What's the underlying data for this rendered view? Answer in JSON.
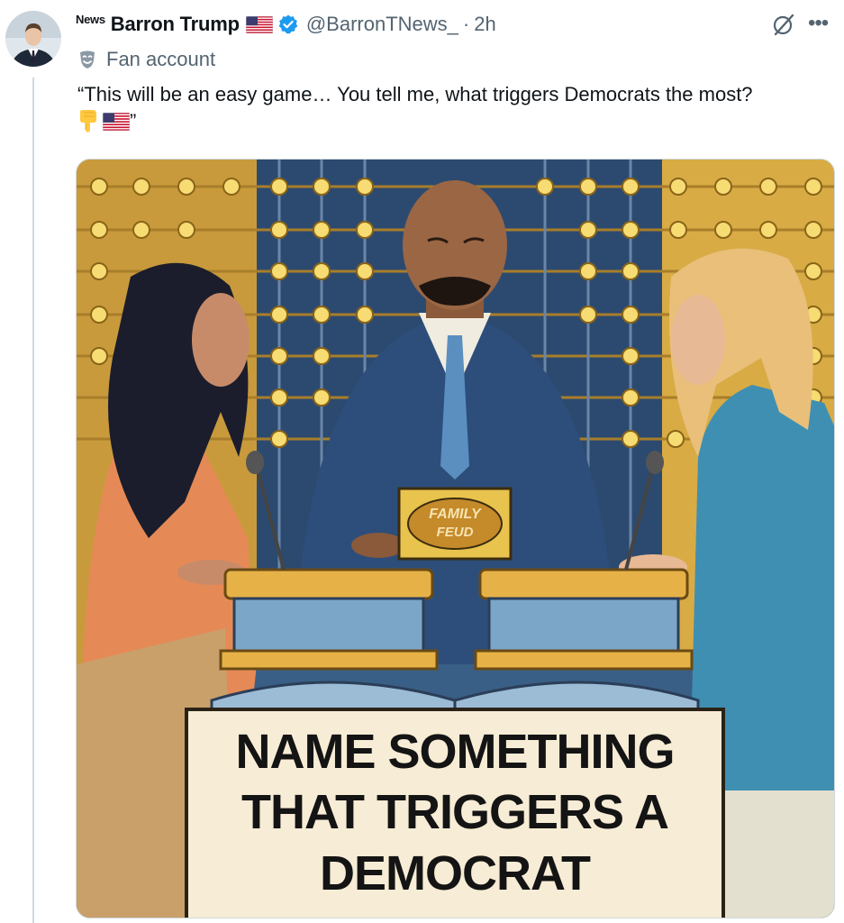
{
  "tweet": {
    "news_badge": "News",
    "display_name": "Barron Trump",
    "handle": "@BarronTNews_",
    "separator": "·",
    "timestamp": "2h",
    "more_label": "•••",
    "fan_label": "Fan account",
    "text_open": "“This will be an easy game… You tell me, what triggers Democrats the most?",
    "text_close": "”"
  },
  "media": {
    "podium_logo_line1": "FAMILY",
    "podium_logo_line2": "FEUD",
    "sign_lines": [
      "NAME SOMETHING",
      "THAT TRIGGERS A",
      "DEMOCRAT"
    ]
  },
  "colors": {
    "verified": "#1d9bf0",
    "muted": "#536471",
    "text": "#0f1419"
  },
  "icons": {
    "verified": "verified-badge-icon",
    "grok": "grok-icon",
    "fan": "theater-mask-icon",
    "emoji1": "pointing-down-emoji",
    "emoji2": "us-flag-emoji"
  }
}
